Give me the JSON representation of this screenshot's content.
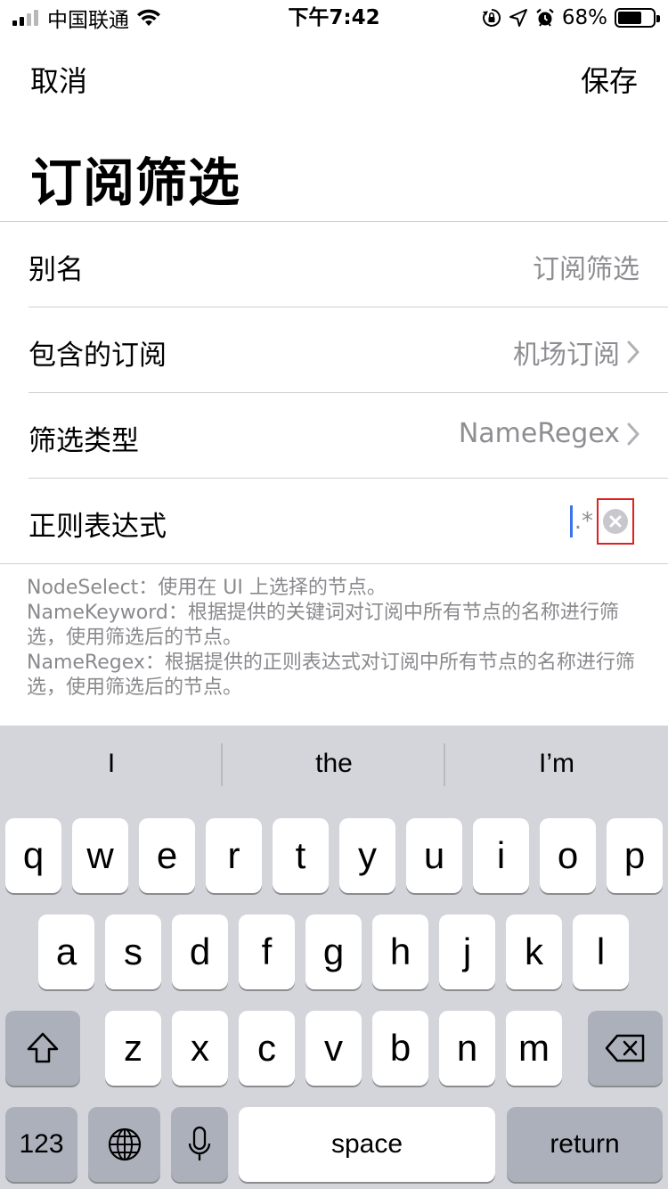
{
  "status_bar": {
    "carrier": "中国联通",
    "time": "下午7:42",
    "battery": "68%",
    "battery_level": 0.68,
    "icons": [
      "signal-icon",
      "wifi-icon",
      "orientation-lock-icon",
      "location-icon",
      "alarm-icon",
      "battery-icon"
    ]
  },
  "nav": {
    "cancel": "取消",
    "save": "保存"
  },
  "title": "订阅筛选",
  "rows": {
    "alias": {
      "label": "别名",
      "value": "订阅筛选"
    },
    "subscription": {
      "label": "包含的订阅",
      "value": "机场订阅"
    },
    "filter_type": {
      "label": "筛选类型",
      "value": "NameRegex"
    },
    "regex": {
      "label": "正则表达式",
      "value": ".*"
    }
  },
  "help": {
    "line1": "NodeSelect：使用在 UI 上选择的节点。",
    "line2": "NameKeyword：根据提供的关键词对订阅中所有节点的名称进行筛选，使用筛选后的节点。",
    "line3": "NameRegex：根据提供的正则表达式对订阅中所有节点的名称进行筛选，使用筛选后的节点。"
  },
  "keyboard": {
    "suggestions": [
      "I",
      "the",
      "I’m"
    ],
    "row1": [
      "q",
      "w",
      "e",
      "r",
      "t",
      "y",
      "u",
      "i",
      "o",
      "p"
    ],
    "row2": [
      "a",
      "s",
      "d",
      "f",
      "g",
      "h",
      "j",
      "k",
      "l"
    ],
    "row3": [
      "z",
      "x",
      "c",
      "v",
      "b",
      "n",
      "m"
    ],
    "numbers": "123",
    "space": "space",
    "return": "return"
  },
  "colors": {
    "accent_cursor": "#3a74f0",
    "secondary_text": "#8e8e93",
    "keyboard_bg": "#d3d5db",
    "highlight_box": "#e02020"
  }
}
